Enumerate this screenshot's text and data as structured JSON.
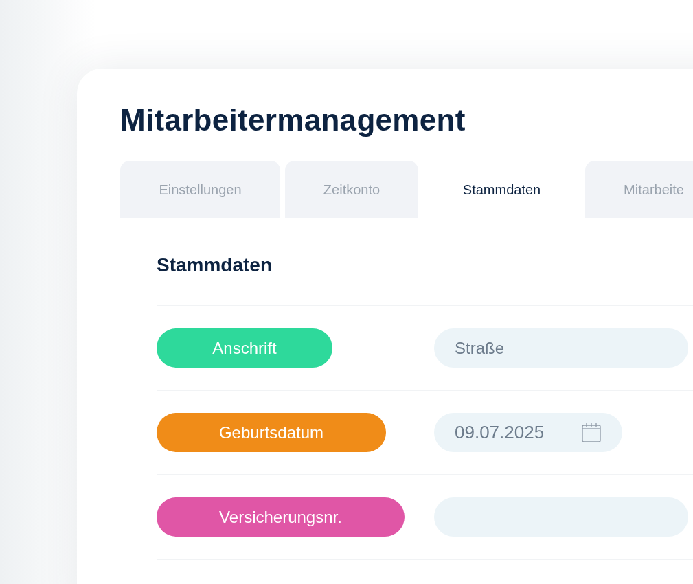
{
  "title": "Mitarbeitermanagement",
  "tabs": [
    {
      "label": "Einstellungen",
      "selected": false
    },
    {
      "label": "Zeitkonto",
      "selected": false
    },
    {
      "label": "Stammdaten",
      "selected": true
    },
    {
      "label": "Mitarbeite",
      "selected": false
    }
  ],
  "section": {
    "heading": "Stammdaten"
  },
  "rows": [
    {
      "label": "Anschrift",
      "color": "#2ed99b",
      "field": {
        "kind": "text",
        "placeholder": "Straße"
      }
    },
    {
      "label": "Geburtsdatum",
      "color": "#f08c18",
      "field": {
        "kind": "date",
        "value": "09.07.2025"
      }
    },
    {
      "label": "Versicherungsnr.",
      "color": "#e056a6",
      "field": {
        "kind": "text"
      }
    }
  ]
}
